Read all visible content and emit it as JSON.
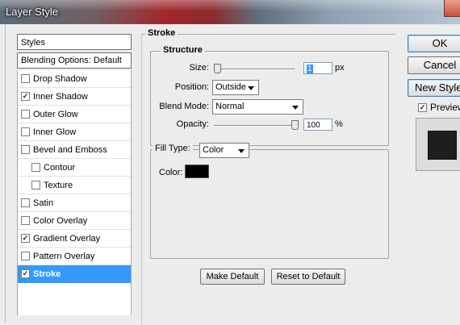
{
  "window": {
    "title": "Layer Style"
  },
  "styles_panel": {
    "header": "Styles",
    "blending_options": "Blending Options: Default",
    "items": [
      {
        "label": "Drop Shadow",
        "checked": false,
        "indent": false,
        "selected": false
      },
      {
        "label": "Inner Shadow",
        "checked": true,
        "indent": false,
        "selected": false
      },
      {
        "label": "Outer Glow",
        "checked": false,
        "indent": false,
        "selected": false
      },
      {
        "label": "Inner Glow",
        "checked": false,
        "indent": false,
        "selected": false
      },
      {
        "label": "Bevel and Emboss",
        "checked": false,
        "indent": false,
        "selected": false
      },
      {
        "label": "Contour",
        "checked": false,
        "indent": true,
        "selected": false
      },
      {
        "label": "Texture",
        "checked": false,
        "indent": true,
        "selected": false
      },
      {
        "label": "Satin",
        "checked": false,
        "indent": false,
        "selected": false
      },
      {
        "label": "Color Overlay",
        "checked": false,
        "indent": false,
        "selected": false
      },
      {
        "label": "Gradient Overlay",
        "checked": true,
        "indent": false,
        "selected": false
      },
      {
        "label": "Pattern Overlay",
        "checked": false,
        "indent": false,
        "selected": false
      },
      {
        "label": "Stroke",
        "checked": true,
        "indent": false,
        "selected": true
      }
    ]
  },
  "stroke": {
    "section_title": "Stroke",
    "structure_title": "Structure",
    "size": {
      "label": "Size:",
      "value": "1",
      "unit": "px",
      "slider_fraction": 0.0
    },
    "position": {
      "label": "Position:",
      "value": "Outside"
    },
    "blend_mode": {
      "label": "Blend Mode:",
      "value": "Normal"
    },
    "opacity": {
      "label": "Opacity:",
      "value": "100",
      "unit": "%",
      "slider_fraction": 1.0
    },
    "fill_type": {
      "label": "Fill Type:",
      "value": "Color"
    },
    "color": {
      "label": "Color:",
      "value": "#000000"
    },
    "make_default": "Make Default",
    "reset_to_default": "Reset to Default"
  },
  "actions": {
    "ok": "OK",
    "cancel": "Cancel",
    "new_style": "New Style...",
    "preview_label": "Preview",
    "preview_checked": true
  },
  "colors": {
    "selection": "#3399ff",
    "stroke_color": "#000000",
    "preview_fill": "#1e1e1e"
  },
  "icons": {
    "checkbox_checked": "check-icon",
    "dropdown": "chevron-down-icon",
    "window_close": "close-icon"
  }
}
